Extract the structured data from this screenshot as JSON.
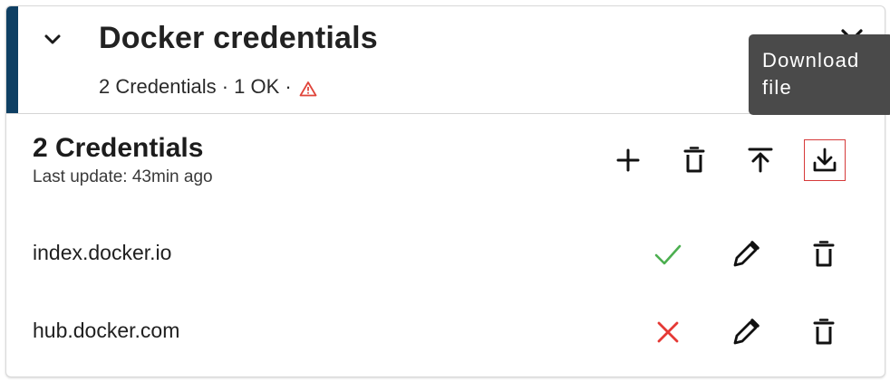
{
  "panel": {
    "title": "Docker credentials",
    "summary": "2 Credentials · 1 OK ·",
    "accent_color": "#0e3f63",
    "warning_color": "#e0443a",
    "icons": {
      "expand": "chevron-down-icon",
      "close": "close-icon",
      "warning": "warning-triangle-icon"
    }
  },
  "list": {
    "title": "2 Credentials",
    "last_update": "Last update: 43min ago",
    "toolbar": [
      {
        "name": "add",
        "icon": "plus-icon"
      },
      {
        "name": "delete-all",
        "icon": "trash-icon"
      },
      {
        "name": "upload",
        "icon": "upload-icon"
      },
      {
        "name": "download",
        "icon": "download-icon"
      }
    ],
    "credentials": [
      {
        "host": "index.docker.io",
        "status": "ok",
        "status_icon": "check-icon",
        "status_color": "#4caf50"
      },
      {
        "host": "hub.docker.com",
        "status": "error",
        "status_icon": "cross-icon",
        "status_color": "#e53935"
      }
    ]
  },
  "tooltip": {
    "line1": "Download",
    "line2": "file"
  }
}
